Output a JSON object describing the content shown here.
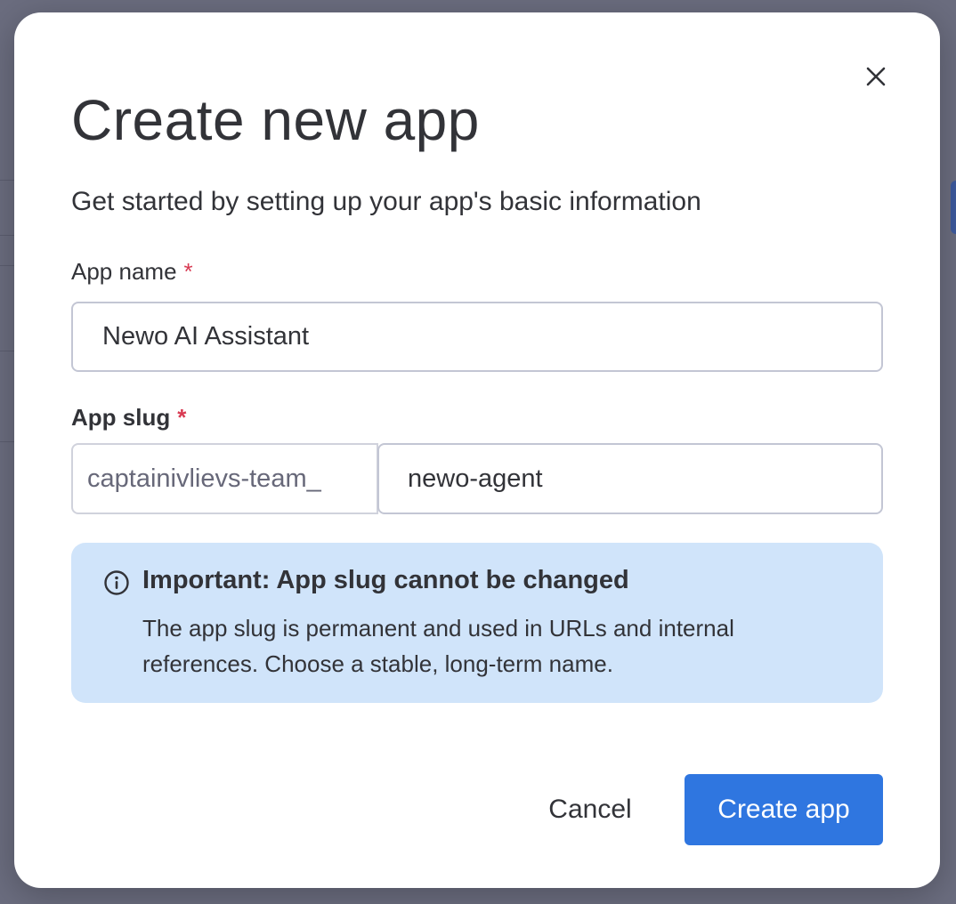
{
  "dialog": {
    "title": "Create new app",
    "subtitle": "Get started by setting up your app's basic information",
    "close_icon": "close-icon"
  },
  "form": {
    "app_name": {
      "label": "App name",
      "required_mark": "*",
      "value": "Newo AI Assistant"
    },
    "app_slug": {
      "label": "App slug",
      "required_mark": "*",
      "prefix": "captainivlievs-team_",
      "value": "newo-agent"
    }
  },
  "notice": {
    "icon": "info-icon",
    "title": "Important: App slug cannot be changed",
    "body": "The app slug is permanent and used in URLs and internal references. Choose a stable, long-term name.",
    "background_color": "#d0e4fa"
  },
  "actions": {
    "cancel_label": "Cancel",
    "create_label": "Create app",
    "primary_color": "#2f76e0"
  },
  "colors": {
    "required": "#d83a52",
    "backdrop": "#6b6d7f"
  }
}
